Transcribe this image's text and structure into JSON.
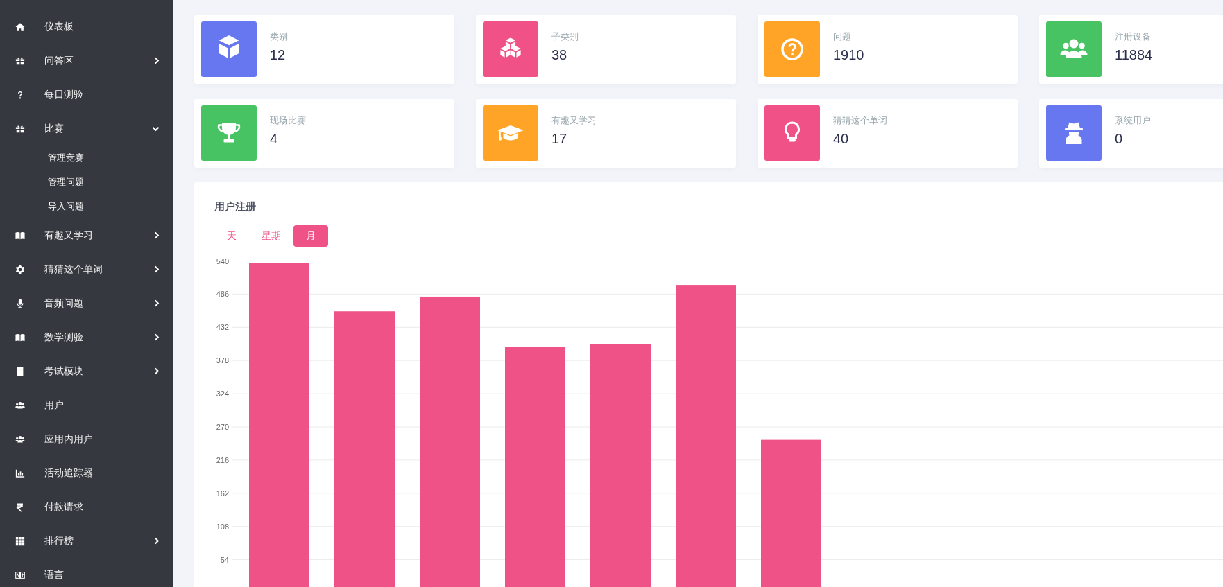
{
  "sidebar": {
    "items": [
      {
        "label": "仪表板",
        "kind": "link"
      },
      {
        "label": "问答区",
        "kind": "group",
        "expanded": false
      },
      {
        "label": "每日测验",
        "kind": "link"
      },
      {
        "label": "比赛",
        "kind": "group",
        "expanded": true,
        "children": [
          {
            "label": "管理竞赛"
          },
          {
            "label": "管理问题"
          },
          {
            "label": "导入问题"
          }
        ]
      },
      {
        "label": "有趣又学习",
        "kind": "group",
        "expanded": false
      },
      {
        "label": "猜猜这个单词",
        "kind": "group",
        "expanded": false
      },
      {
        "label": "音频问题",
        "kind": "group",
        "expanded": false
      },
      {
        "label": "数学测验",
        "kind": "group",
        "expanded": false
      },
      {
        "label": "考试模块",
        "kind": "group",
        "expanded": false
      },
      {
        "label": "用户",
        "kind": "link"
      },
      {
        "label": "应用内用户",
        "kind": "link"
      },
      {
        "label": "活动追踪器",
        "kind": "link"
      },
      {
        "label": "付款请求",
        "kind": "link"
      },
      {
        "label": "排行榜",
        "kind": "group",
        "expanded": false
      },
      {
        "label": "语言",
        "kind": "link"
      }
    ]
  },
  "stats": [
    {
      "label": "类别",
      "value": "12",
      "color": "#6777ef"
    },
    {
      "label": "子类别",
      "value": "38",
      "color": "#f05287"
    },
    {
      "label": "问题",
      "value": "1910",
      "color": "#ffa426"
    },
    {
      "label": "注册设备",
      "value": "11884",
      "color": "#47c363"
    },
    {
      "label": "现场比赛",
      "value": "4",
      "color": "#47c363"
    },
    {
      "label": "有趣又学习",
      "value": "17",
      "color": "#ffa426"
    },
    {
      "label": "猜猜这个单词",
      "value": "40",
      "color": "#f05287"
    },
    {
      "label": "系统用户",
      "value": "0",
      "color": "#6777ef"
    }
  ],
  "registrations": {
    "title": "用户注册",
    "tabs": [
      {
        "label": "天",
        "selected": false
      },
      {
        "label": "星期",
        "selected": false
      },
      {
        "label": "月",
        "selected": true
      }
    ],
    "chart_data": {
      "type": "bar",
      "grid": true,
      "ylim": [
        0,
        540
      ],
      "yticks": [
        54,
        108,
        162,
        216,
        270,
        324,
        378,
        432,
        486,
        540
      ],
      "series": [
        {
          "color": "#ef5286",
          "values": [
            537,
            458,
            482,
            400,
            405,
            501,
            249
          ]
        }
      ]
    }
  }
}
